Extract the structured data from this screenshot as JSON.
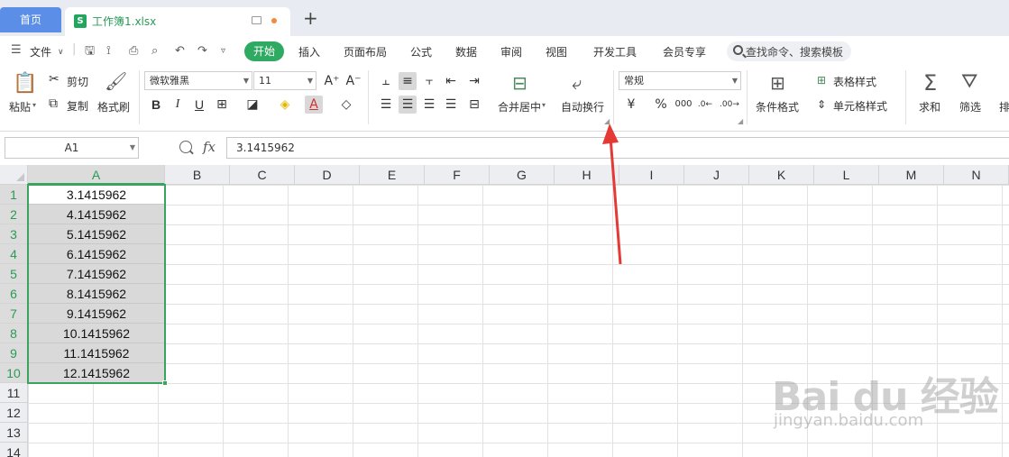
{
  "tabs": {
    "home": "首页",
    "file_icon": "S",
    "file_name": "工作簿1.xlsx",
    "new_tab": "+"
  },
  "menu": {
    "file": "文件",
    "items": [
      "开始",
      "插入",
      "页面布局",
      "公式",
      "数据",
      "审阅",
      "视图",
      "开发工具",
      "会员专享"
    ],
    "search": "查找命令、搜索模板"
  },
  "ribbon": {
    "paste": "粘贴",
    "cut": "剪切",
    "copy": "复制",
    "format_painter": "格式刷",
    "font_name": "微软雅黑",
    "font_size": "11",
    "merge_center": "合并居中",
    "wrap_text": "自动换行",
    "number_format": "常规",
    "conditional_format": "条件格式",
    "table_style": "表格样式",
    "cell_style": "单元格样式",
    "sum": "求和",
    "filter": "筛选",
    "sort": "排"
  },
  "formula_bar": {
    "name_box": "A1",
    "fx": "fx",
    "value": "3.1415962"
  },
  "grid": {
    "columns": [
      "A",
      "B",
      "C",
      "D",
      "E",
      "F",
      "G",
      "H",
      "I",
      "J",
      "K",
      "L",
      "M",
      "N"
    ],
    "rows": [
      "1",
      "2",
      "3",
      "4",
      "5",
      "6",
      "7",
      "8",
      "9",
      "10",
      "11",
      "12",
      "13",
      "14"
    ],
    "colA_values": [
      "3.1415962",
      "4.1415962",
      "5.1415962",
      "6.1415962",
      "7.1415962",
      "8.1415962",
      "9.1415962",
      "10.1415962",
      "11.1415962",
      "12.1415962"
    ]
  },
  "watermark": {
    "main": "Bai du 经验",
    "sub": "jingyan.baidu.com"
  },
  "colors": {
    "accent_green": "#2faa62",
    "home_tab_blue": "#5b8ee6",
    "annotation_red": "#e53935"
  }
}
